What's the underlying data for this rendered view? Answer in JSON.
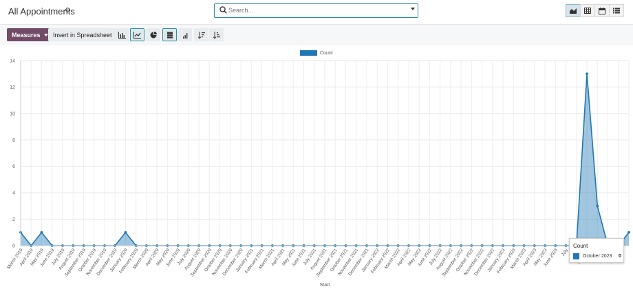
{
  "header": {
    "title": "All Appointments",
    "search_placeholder": "Search..."
  },
  "view_switcher": {
    "items": [
      "graph-view",
      "pivot-view",
      "calendar-view",
      "list-view"
    ],
    "active": "graph-view"
  },
  "toolbar": {
    "measures_label": "Measures",
    "spreadsheet_label": "Insert in Spreadsheet",
    "chart_type_buttons": [
      "bar-chart",
      "line-chart",
      "pie-chart"
    ],
    "active_chart_type": "line-chart",
    "stacked_active": true
  },
  "colors": {
    "accent": "#714B67",
    "series": "#1f77b4",
    "focus": "#2a8f9a"
  },
  "chart_data": {
    "type": "area",
    "xlabel": "Start",
    "ylabel": "",
    "ylim": [
      0,
      14
    ],
    "yticks": [
      0,
      2,
      4,
      6,
      8,
      10,
      12,
      14
    ],
    "grid": true,
    "legend_position": "top-center",
    "categories": [
      "March 2019",
      "April 2019",
      "May 2019",
      "June 2019",
      "July 2019",
      "August 2019",
      "September 2019",
      "October 2019",
      "November 2019",
      "December 2019",
      "January 2020",
      "February 2020",
      "March 2020",
      "April 2020",
      "May 2020",
      "June 2020",
      "July 2020",
      "August 2020",
      "September 2020",
      "October 2020",
      "November 2020",
      "December 2020",
      "January 2021",
      "February 2021",
      "March 2021",
      "April 2021",
      "May 2021",
      "June 2021",
      "July 2021",
      "August 2021",
      "September 2021",
      "October 2021",
      "November 2021",
      "December 2021",
      "January 2022",
      "February 2022",
      "March 2022",
      "April 2022",
      "May 2022",
      "June 2022",
      "July 2022",
      "August 2022",
      "September 2022",
      "October 2022",
      "November 2022",
      "December 2022",
      "January 2023",
      "February 2023",
      "March 2023",
      "April 2023",
      "May 2023",
      "June 2023",
      "July 2023",
      "August 2023",
      "September 2023",
      "October 2023",
      "November 2023",
      "December 2023"
    ],
    "tick_labels": [
      "March 2019",
      "April 2019",
      "May 2019",
      "June 2019",
      "July 2019",
      "August 2019",
      "September 2019",
      "October 2019",
      "November 2019",
      "December 2019",
      "January 2020",
      "February 2020",
      "March 2020",
      "April 2020",
      "May 2020",
      "June 2020",
      "July 2020",
      "August 2020",
      "September 2020",
      "October 2020",
      "November 2020",
      "December 2020",
      "January 2021",
      "February 2021",
      "March 2021",
      "April 2021",
      "May 2021",
      "June 2021",
      "July 2021",
      "August 2021",
      "September 2021",
      "October 2021",
      "November 2021",
      "December 2021",
      "January 2022",
      "February 2022",
      "March 2022",
      "April 2022",
      "May 2022",
      "June 2022",
      "July 2022",
      "August 2022",
      "September 2022",
      "October 2022",
      "November 2022",
      "December 2022",
      "January 2023",
      "February 2023",
      "March 2023",
      "April 2023",
      "May 2023",
      "June 2023",
      "July",
      "Augu",
      "Septemb",
      "Octob",
      "Novemb",
      "Decemb"
    ],
    "series": [
      {
        "name": "Count",
        "values": [
          1,
          0,
          1,
          0,
          0,
          0,
          0,
          0,
          0,
          0,
          1,
          0,
          0,
          0,
          0,
          0,
          0,
          0,
          0,
          0,
          0,
          0,
          0,
          0,
          0,
          0,
          0,
          0,
          0,
          0,
          0,
          0,
          0,
          0,
          0,
          0,
          0,
          0,
          0,
          0,
          0,
          0,
          0,
          0,
          0,
          0,
          0,
          0,
          0,
          0,
          0,
          0,
          0,
          0,
          13,
          3,
          0,
          0,
          1
        ]
      }
    ]
  },
  "tooltip": {
    "title": "Count",
    "label": "October 2023",
    "value": "0"
  }
}
